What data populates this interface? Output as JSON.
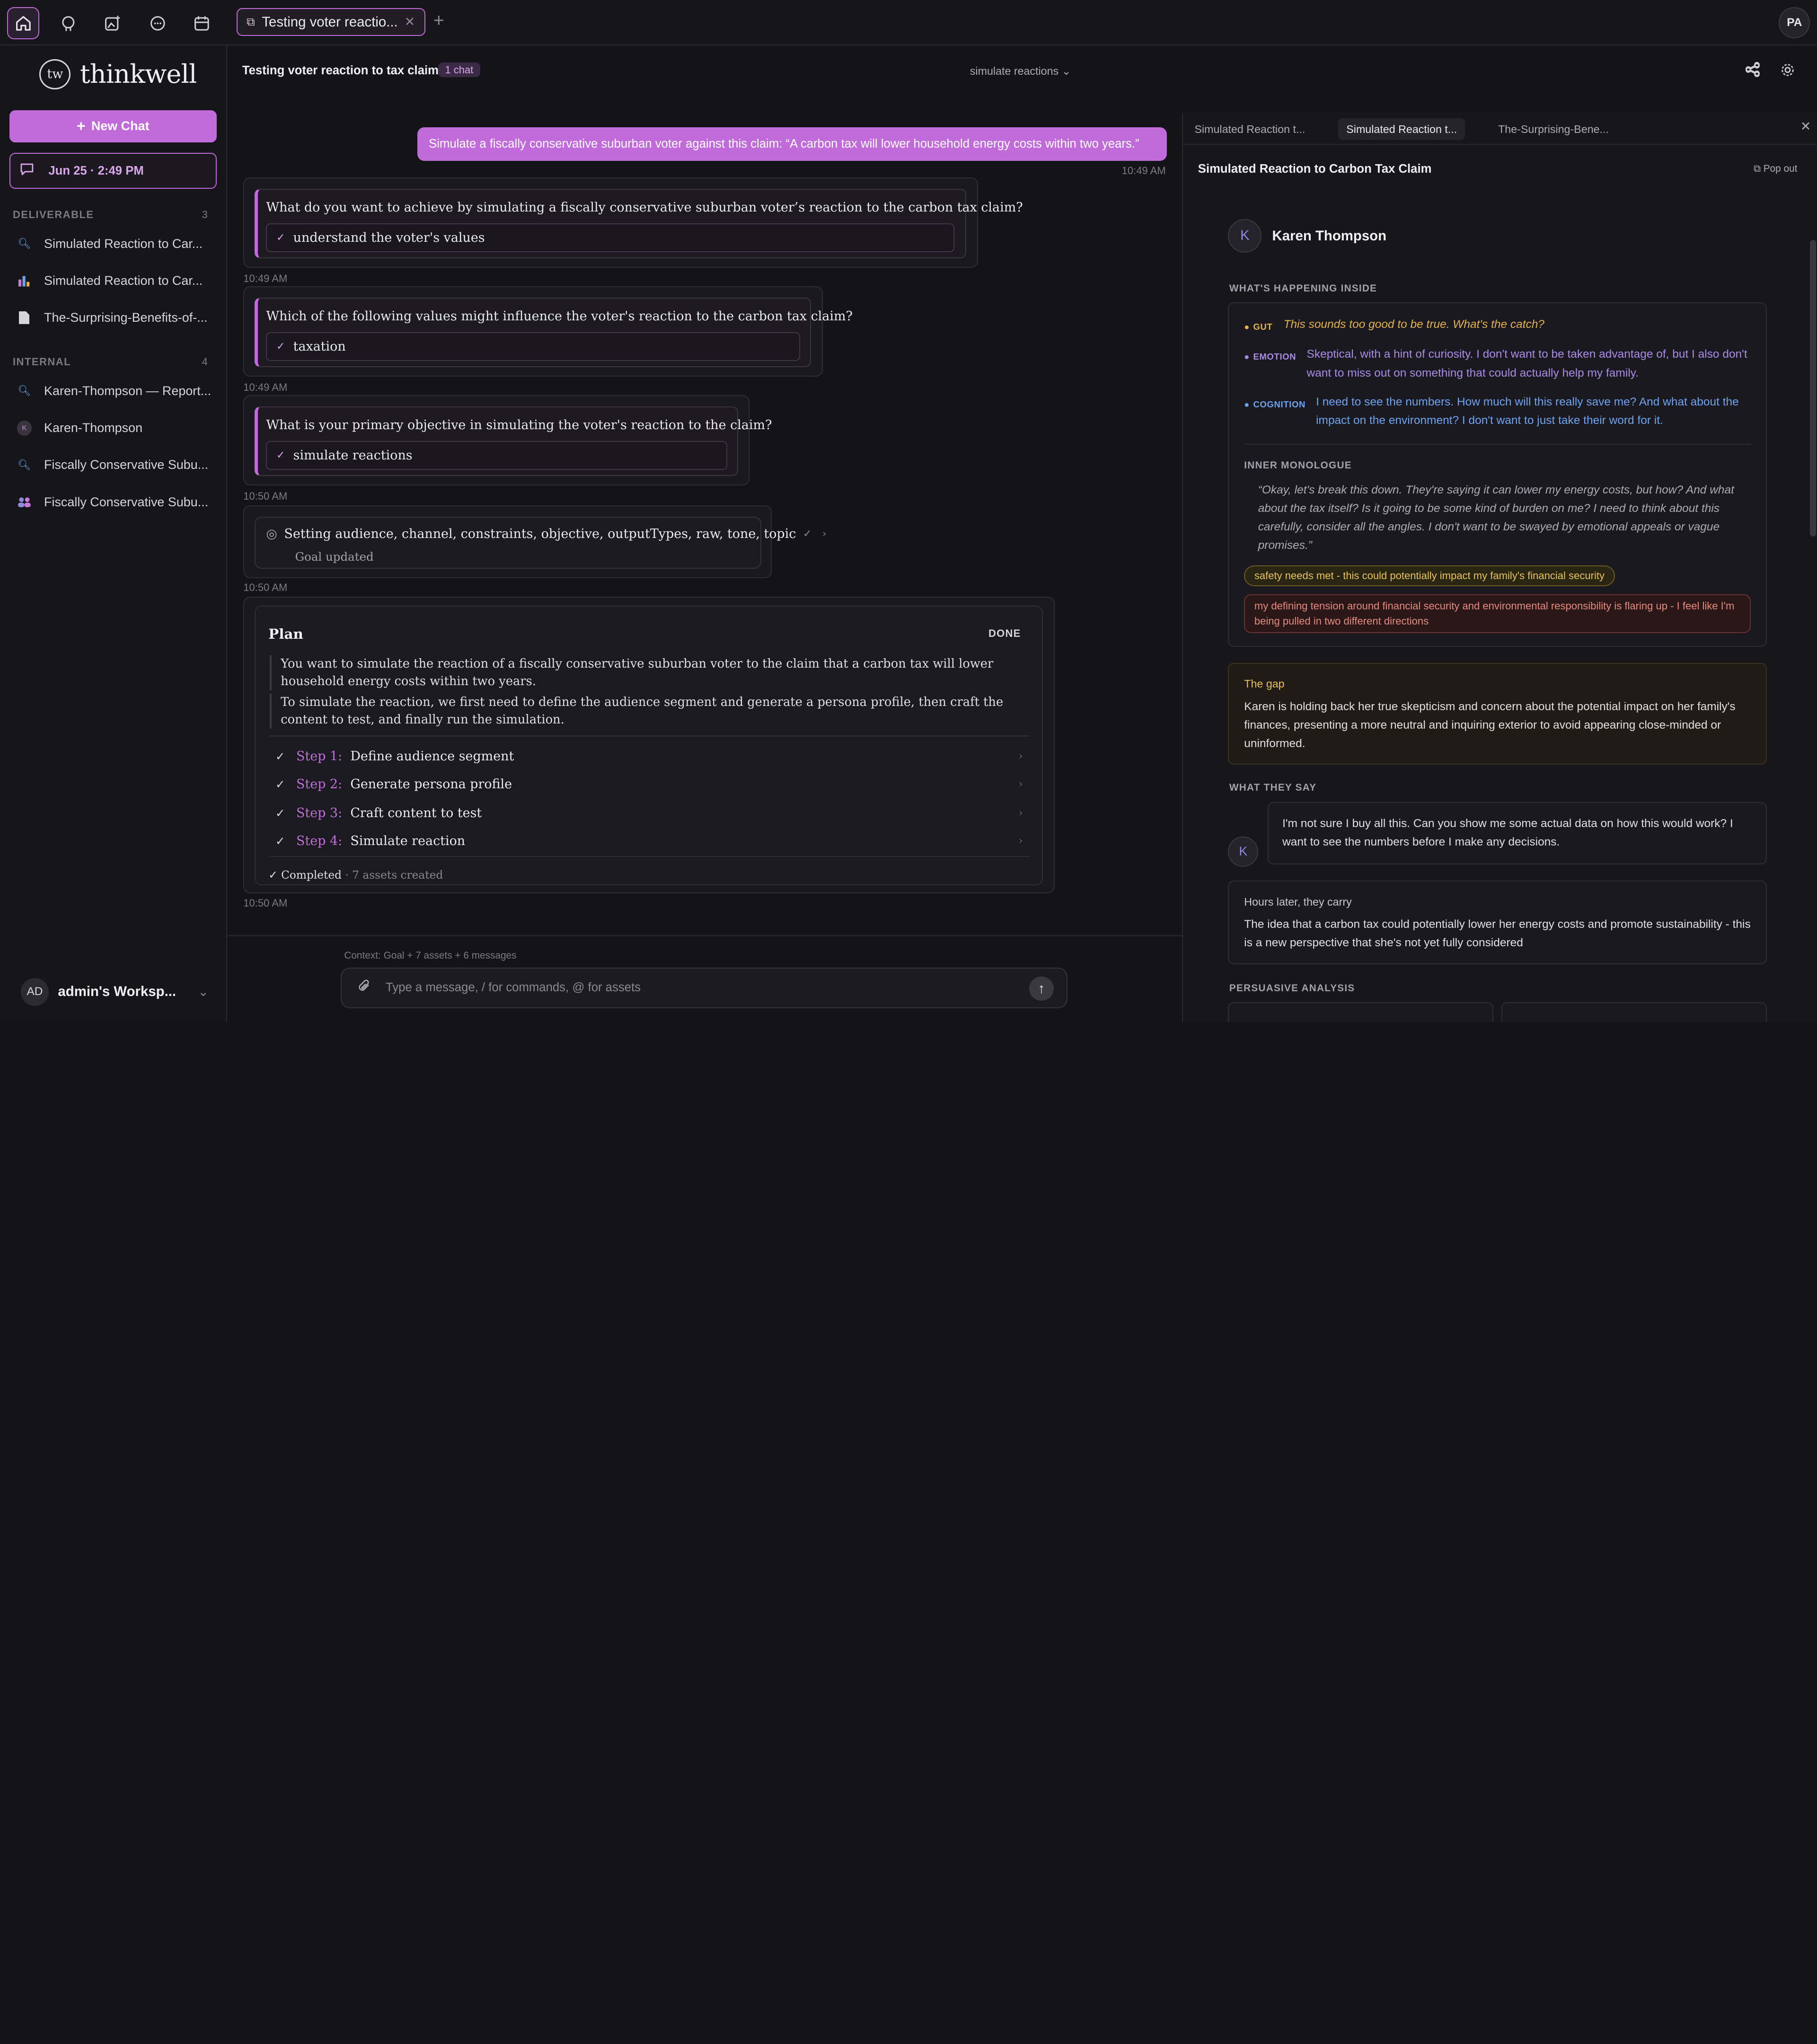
{
  "topbar": {
    "tab_title": "Testing voter reactio...",
    "user_initials": "PA"
  },
  "sidebar": {
    "brand": "thinkwell",
    "logo_mark": "tw",
    "new_chat": "New Chat",
    "session": "Jun 25 · 2:49 PM",
    "deliverable": {
      "label": "DELIVERABLE",
      "count": "3",
      "items": [
        {
          "label": "Simulated Reaction to Car...",
          "icon": "search-icon"
        },
        {
          "label": "Simulated Reaction to Car...",
          "icon": "chart-icon"
        },
        {
          "label": "The-Surprising-Benefits-of-...",
          "icon": "document-icon"
        }
      ]
    },
    "internal": {
      "label": "INTERNAL",
      "count": "4",
      "items": [
        {
          "label": "Karen-Thompson — Report...",
          "icon": "search-icon"
        },
        {
          "label": "Karen-Thompson",
          "icon": "avatar-icon",
          "avatar": "K"
        },
        {
          "label": "Fiscally Conservative Subu...",
          "icon": "search-icon"
        },
        {
          "label": "Fiscally Conservative Subu...",
          "icon": "users-icon"
        }
      ]
    },
    "workspace": {
      "initials": "AD",
      "name": "admin's Worksp..."
    }
  },
  "chat": {
    "title": "Testing voter reaction to tax claim",
    "badge": "1 chat",
    "mode": "simulate reactions",
    "user_message": "Simulate a fiscally conservative suburban voter against this claim: “A carbon tax will lower household energy costs within two years.”",
    "user_time": "10:49 AM",
    "questions": [
      {
        "q": "What do you want to achieve by simulating a fiscally conservative suburban voter’s reaction to the carbon tax claim?",
        "a": "understand the voter's values",
        "time": "10:49 AM"
      },
      {
        "q": "Which of the following values might influence the voter's reaction to the carbon tax claim?",
        "a": "taxation",
        "time": "10:49 AM"
      },
      {
        "q": "What is your primary objective in simulating the voter's reaction to the claim?",
        "a": "simulate reactions",
        "time": "10:50 AM"
      }
    ],
    "goal": {
      "text": "Setting audience, channel, constraints, objective, outputTypes, raw, tone, topic",
      "sub": "Goal updated",
      "time": "10:50 AM"
    },
    "plan": {
      "title": "Plan",
      "status": "DONE",
      "para1": "You want to simulate the reaction of a fiscally conservative suburban voter to the claim that a carbon tax will lower household energy costs within two years.",
      "para2": "To simulate the reaction, we first need to define the audience segment and generate a persona profile, then craft the content to test, and finally run the simulation.",
      "steps": [
        {
          "num": "Step 1:",
          "label": "Define audience segment"
        },
        {
          "num": "Step 2:",
          "label": "Generate persona profile"
        },
        {
          "num": "Step 3:",
          "label": "Craft content to test"
        },
        {
          "num": "Step 4:",
          "label": "Simulate reaction"
        }
      ],
      "completed": "Completed",
      "assets": "· 7 assets created",
      "time": "10:50 AM"
    },
    "composer": {
      "context": "Context: Goal + 7 assets + 6 messages",
      "placeholder": "Type a message, / for commands, @ for assets"
    }
  },
  "panel": {
    "tabs": [
      "Simulated Reaction t...",
      "Simulated Reaction t...",
      "The-Surprising-Bene..."
    ],
    "heading": "Simulated Reaction to Carbon Tax Claim",
    "popout": "Pop out",
    "persona": {
      "initial": "K",
      "name": "Karen Thompson"
    },
    "inside_label": "WHAT'S HAPPENING INSIDE",
    "gut_tag": "GUT",
    "gut": "This sounds too good to be true. What's the catch?",
    "emotion_tag": "EMOTION",
    "emotion": "Skeptical, with a hint of curiosity. I don't want to be taken advantage of, but I also don't want to miss out on something that could actually help my family.",
    "cognition_tag": "COGNITION",
    "cognition": "I need to see the numbers. How much will this really save me? And what about the impact on the environment? I don't want to just take their word for it.",
    "monologue_label": "INNER MONOLOGUE",
    "monologue": "“Okay, let's break this down. They're saying it can lower my energy costs, but how? And what about the tax itself? Is it going to be some kind of burden on me? I need to think about this carefully, consider all the angles. I don't want to be swayed by emotional appeals or vague promises.”",
    "pill_safety": "safety needs met - this could potentially impact my family's financial security",
    "pill_tension": "my defining tension around financial security and environmental responsibility is flaring up - I feel like I'm being pulled in two different directions",
    "gap_title": "The gap",
    "gap": "Karen is holding back her true skepticism and concern about the potential impact on her family's finances, presenting a more neutral and inquiring exterior to avoid appearing close-minded or uninformed.",
    "say_label": "WHAT THEY SAY",
    "say": "I'm not sure I buy all this. Can you show me some actual data on how this would work? I want to see the numbers before I make any decisions.",
    "later_title": "Hours later, they carry",
    "later": "The idea that a carbon tax could potentially lower her energy costs and promote sustainability - this is a new perspective that she's not yet fully considered",
    "analysis_label": "PERSUASIVE ANALYSIS"
  },
  "colors": {
    "accent": "#c06bd9",
    "gut": "#e6b24a",
    "emotion": "#a98ce6",
    "cognition": "#6ea3f0",
    "gap": "#e6c05a"
  }
}
